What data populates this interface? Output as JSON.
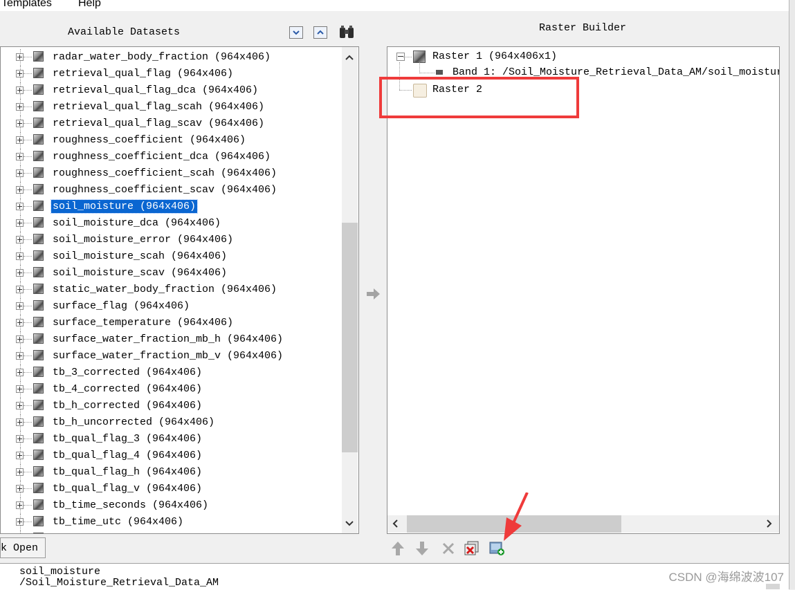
{
  "menu": {
    "templates": "Templates",
    "help": "Help"
  },
  "datasets_panel": {
    "title": "Available Datasets",
    "selected_index": 9,
    "items": [
      "radar_water_body_fraction (964x406)",
      "retrieval_qual_flag (964x406)",
      "retrieval_qual_flag_dca (964x406)",
      "retrieval_qual_flag_scah (964x406)",
      "retrieval_qual_flag_scav (964x406)",
      "roughness_coefficient (964x406)",
      "roughness_coefficient_dca (964x406)",
      "roughness_coefficient_scah (964x406)",
      "roughness_coefficient_scav (964x406)",
      "soil_moisture (964x406)",
      "soil_moisture_dca (964x406)",
      "soil_moisture_error (964x406)",
      "soil_moisture_scah (964x406)",
      "soil_moisture_scav (964x406)",
      "static_water_body_fraction (964x406)",
      "surface_flag (964x406)",
      "surface_temperature (964x406)",
      "surface_water_fraction_mb_h (964x406)",
      "surface_water_fraction_mb_v (964x406)",
      "tb_3_corrected (964x406)",
      "tb_4_corrected (964x406)",
      "tb_h_corrected (964x406)",
      "tb_h_uncorrected (964x406)",
      "tb_qual_flag_3 (964x406)",
      "tb_qual_flag_4 (964x406)",
      "tb_qual_flag_h (964x406)",
      "tb_qual_flag_v (964x406)",
      "tb_time_seconds (964x406)",
      "tb_time_utc (964x406)"
    ],
    "open_button": "k Open"
  },
  "raster_builder": {
    "title": "Raster Builder",
    "raster1": "Raster 1 (964x406x1)",
    "band1": "Band 1: /Soil_Moisture_Retrieval_Data_AM/soil_moistur",
    "raster2": "Raster 2"
  },
  "info": {
    "line1": "soil_moisture",
    "line2": "/Soil_Moisture_Retrieval_Data_AM"
  },
  "watermark": "CSDN @海绵波波107",
  "colors": {
    "selection": "#0a66d1",
    "highlight_box": "#ef3b3b",
    "annotation_arrow": "#ef3b3b"
  },
  "icons": [
    "expand-icon",
    "collapse-icon",
    "binoculars-icon",
    "add-arrow-icon",
    "move-up-icon",
    "move-down-icon",
    "delete-icon",
    "remove-raster-icon",
    "new-raster-icon"
  ]
}
